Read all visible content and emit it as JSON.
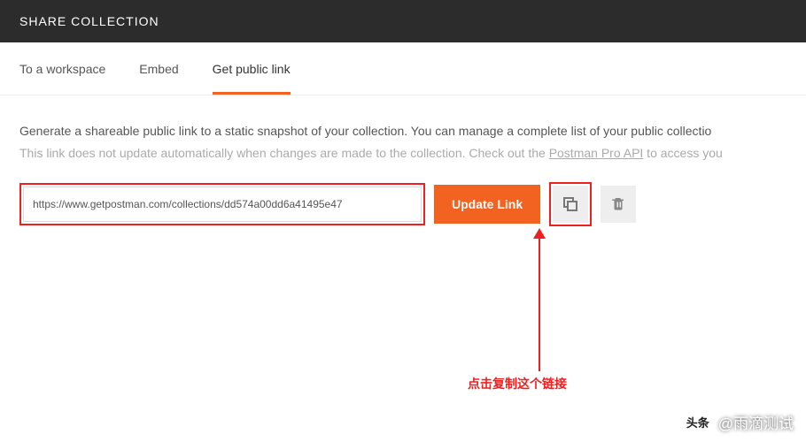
{
  "header": {
    "title": "SHARE COLLECTION"
  },
  "tabs": {
    "items": [
      {
        "label": "To a workspace"
      },
      {
        "label": "Embed"
      },
      {
        "label": "Get public link"
      }
    ],
    "activeIndex": 2
  },
  "desc": {
    "line1": "Generate a shareable public link to a static snapshot of your collection. You can manage a complete list of your public collectio",
    "line2_pre": "This link does not update automatically when changes are made to the collection. Check out the ",
    "line2_link": "Postman Pro API",
    "line2_post": " to access you"
  },
  "link": {
    "value": "https://www.getpostman.com/collections/dd574a00dd6a41495e47",
    "updateLabel": "Update Link"
  },
  "annotation": {
    "text": "点击复制这个链接"
  },
  "watermark": {
    "badge": "头条",
    "text": "@雨滴测试"
  }
}
